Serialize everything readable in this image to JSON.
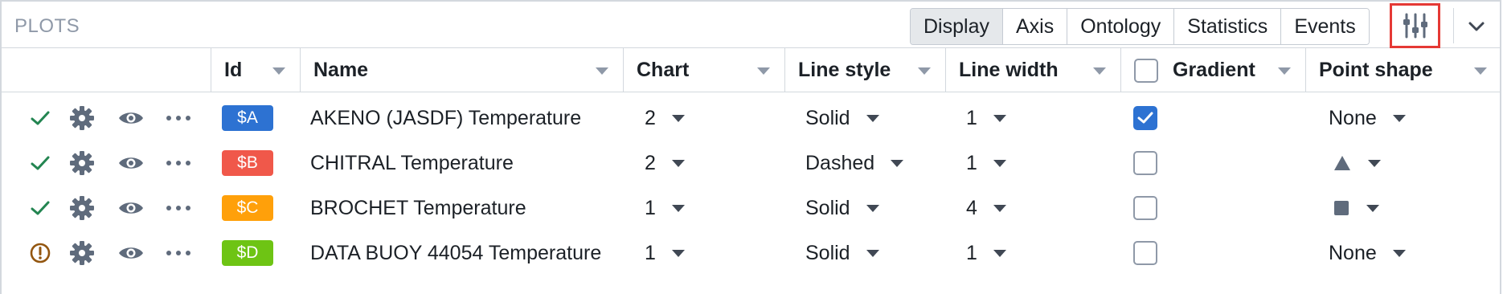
{
  "panel": {
    "title": "PLOTS",
    "tabs": [
      "Display",
      "Axis",
      "Ontology",
      "Statistics",
      "Events"
    ],
    "active_tab": "Display",
    "icons": {
      "settings": "sliders-icon",
      "collapse": "chevron-down-icon"
    }
  },
  "columns": {
    "id": "Id",
    "name": "Name",
    "chart": "Chart",
    "line_style": "Line style",
    "line_width": "Line width",
    "gradient": "Gradient",
    "point_shape": "Point shape"
  },
  "rows": [
    {
      "status": "ok",
      "id": "$A",
      "id_color": "#2d72d2",
      "name": "AKENO (JASDF) Temperature",
      "chart": "2",
      "line_style": "Solid",
      "line_width": "1",
      "gradient": true,
      "point_shape": "None",
      "shape_icon": ""
    },
    {
      "status": "ok",
      "id": "$B",
      "id_color": "#f0584a",
      "name": "CHITRAL Temperature",
      "chart": "2",
      "line_style": "Dashed",
      "line_width": "1",
      "gradient": false,
      "point_shape": "",
      "shape_icon": "triangle"
    },
    {
      "status": "ok",
      "id": "$C",
      "id_color": "#ffa00a",
      "name": "BROCHET Temperature",
      "chart": "1",
      "line_style": "Solid",
      "line_width": "4",
      "gradient": false,
      "point_shape": "",
      "shape_icon": "square"
    },
    {
      "status": "warning",
      "id": "$D",
      "id_color": "#6ec414",
      "name": "DATA BUOY 44054 Temperature",
      "chart": "1",
      "line_style": "Solid",
      "line_width": "1",
      "gradient": false,
      "point_shape": "None",
      "shape_icon": ""
    }
  ],
  "colors": {
    "check_ok": "#238551",
    "warning": "#935610",
    "icon_gray": "#5f6b7c",
    "accent": "#2d72d2"
  }
}
